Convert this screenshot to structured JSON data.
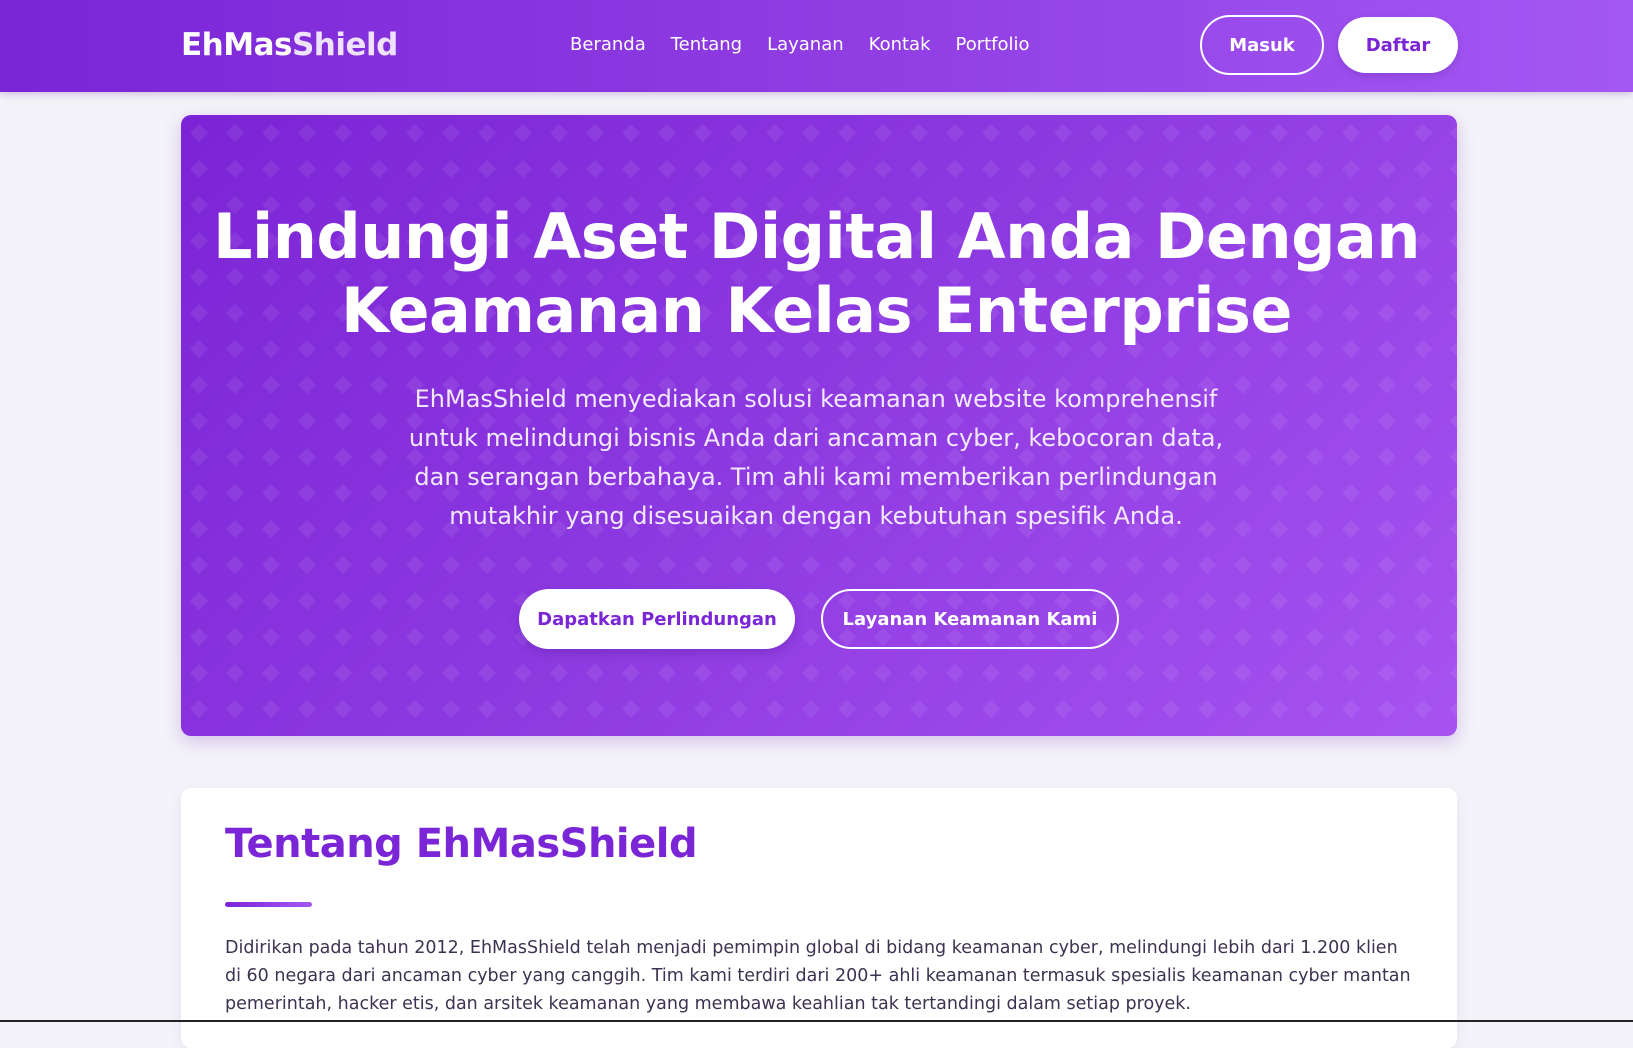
{
  "brand": {
    "part1": "EhMas",
    "part2": "Shield"
  },
  "nav": {
    "links": [
      "Beranda",
      "Tentang",
      "Layanan",
      "Kontak",
      "Portfolio"
    ],
    "login_label": "Masuk",
    "register_label": "Daftar"
  },
  "hero": {
    "title_line1": "Lindungi Aset Digital Anda Dengan",
    "title_line2": "Keamanan Kelas Enterprise",
    "description": "EhMasShield menyediakan solusi keamanan website komprehensif untuk melindungi bisnis Anda dari ancaman cyber, kebocoran data, dan serangan berbahaya. Tim ahli kami memberikan perlindungan mutakhir yang disesuaikan dengan kebutuhan spesifik Anda.",
    "primary_button": "Dapatkan Perlindungan",
    "secondary_button": "Layanan Keamanan Kami"
  },
  "about": {
    "title": "Tentang EhMasShield",
    "text": "Didirikan pada tahun 2012, EhMasShield telah menjadi pemimpin global di bidang keamanan cyber, melindungi lebih dari 1.200 klien di 60 negara dari ancaman cyber yang canggih. Tim kami terdiri dari 200+ ahli keamanan termasuk spesialis keamanan cyber mantan pemerintah, hacker etis, dan arsitek keamanan yang membawa keahlian tak tertandingi dalam setiap proyek."
  },
  "colors": {
    "primary": "#7a25d6",
    "primary_light": "#a458f3",
    "page_background": "#f4f3f9"
  }
}
